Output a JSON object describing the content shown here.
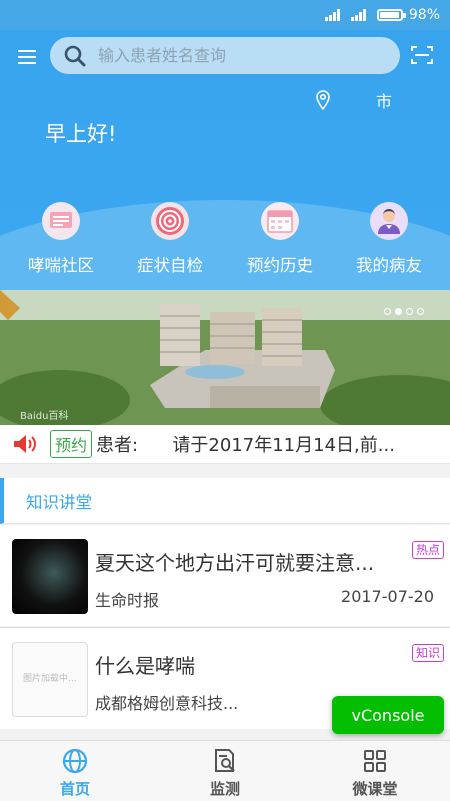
{
  "status_bar": {
    "battery": "98%"
  },
  "header": {
    "search_placeholder": "输入患者姓名查询",
    "city": "市",
    "greeting": "早上好!"
  },
  "features": [
    {
      "label": "哮喘社区",
      "icon": "community-icon",
      "color": "#f08aa3"
    },
    {
      "label": "症状自检",
      "icon": "target-icon",
      "color": "#f06a7a"
    },
    {
      "label": "预约历史",
      "icon": "calendar-icon",
      "color": "#f3a8b8"
    },
    {
      "label": "我的病友",
      "icon": "doctor-avatar-icon",
      "color": "#8e6fd0"
    }
  ],
  "banner": {
    "watermark": "Baidu百科",
    "slides": 4,
    "active_slide": 1
  },
  "notice": {
    "tag": "预约",
    "text": "患者:      请于2017年11月14日,前..."
  },
  "knowledge": {
    "title": "知识讲堂",
    "articles": [
      {
        "title": "夏天这个地方出汗可就要注意...",
        "source": "生命时报",
        "date": "2017-07-20",
        "badge": "热点"
      },
      {
        "title": "什么是哮喘",
        "source": "成都格姆创意科技...",
        "date": "",
        "badge": "知识",
        "thumb_text": "图片加载中..."
      }
    ]
  },
  "vconsole": "vConsole",
  "tabbar": {
    "tabs": [
      {
        "label": "首页",
        "icon": "globe-icon",
        "active": true
      },
      {
        "label": "监测",
        "icon": "monitor-report-icon",
        "active": false
      },
      {
        "label": "微课堂",
        "icon": "grid-icon",
        "active": false
      }
    ]
  },
  "colors": {
    "primary": "#3aa8f0",
    "badge": "#c63fd4",
    "tag_green": "#3aa64a",
    "vconsole": "#04be02"
  }
}
